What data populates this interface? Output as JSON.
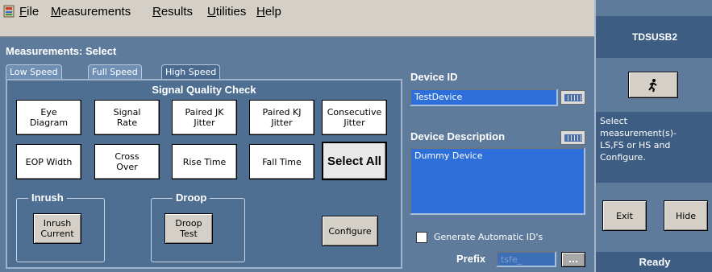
{
  "menu": {
    "items": [
      {
        "first": "F",
        "rest": "ile"
      },
      {
        "first": "M",
        "rest": "easurements"
      },
      {
        "first": "R",
        "rest": "esults"
      },
      {
        "first": "U",
        "rest": "tilities"
      },
      {
        "first": "H",
        "rest": "elp"
      }
    ]
  },
  "panel": {
    "title": "Measurements: Select",
    "tabs": [
      "Low Speed",
      "Full Speed",
      "High Speed"
    ],
    "active_tab": "High Speed",
    "sqc_title": "Signal Quality Check",
    "measurements": [
      "Eye\nDiagram",
      "Signal\nRate",
      "Paired JK\nJitter",
      "Paired KJ\nJitter",
      "Consecutive\nJitter",
      "EOP Width",
      "Cross\nOver",
      "Rise Time",
      "Fall Time",
      "Select All"
    ],
    "inrush": {
      "label": "Inrush",
      "button": "Inrush\nCurrent"
    },
    "droop": {
      "label": "Droop",
      "button": "Droop\nTest"
    },
    "configure": "Configure"
  },
  "device": {
    "id_label": "Device ID",
    "id_value": "TestDevice",
    "desc_label": "Device Description",
    "desc_value": "Dummy Device",
    "auto_id_label": "Generate Automatic ID's",
    "prefix_label": "Prefix",
    "prefix_value": "tsfe_",
    "browse_label": "..."
  },
  "right": {
    "title": "TDSUSB2",
    "message": "Select\nmeasurement(s)-\nLS,FS or HS and\nConfigure.",
    "exit": "Exit",
    "hide": "Hide",
    "status": "Ready"
  },
  "colors": {
    "panel": "#5e7b9b",
    "dark": "#3e5d82",
    "field": "#2f6fd9"
  }
}
